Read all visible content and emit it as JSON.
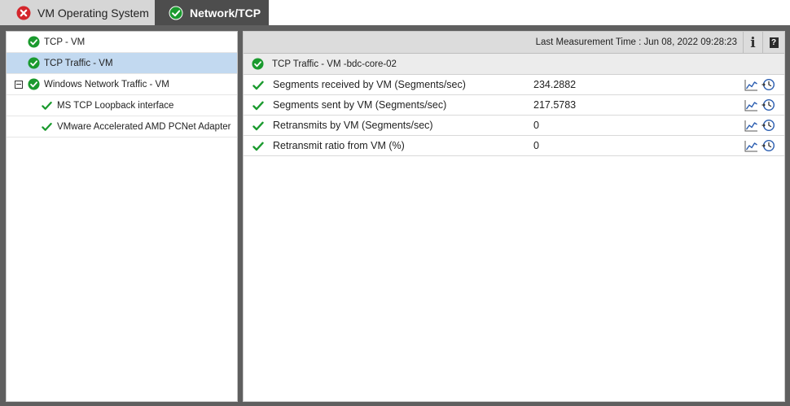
{
  "tabs": [
    {
      "label": "VM Operating System",
      "status": "error"
    },
    {
      "label": "Network/TCP",
      "status": "ok",
      "active": true
    }
  ],
  "tree": [
    {
      "label": "TCP - VM",
      "icon": "ok-circle-icon",
      "selected": false
    },
    {
      "label": "TCP Traffic - VM",
      "icon": "ok-circle-icon",
      "selected": true
    },
    {
      "label": "Windows Network Traffic - VM",
      "icon": "ok-circle-icon",
      "expander": "collapse-icon"
    },
    {
      "label": "MS TCP Loopback interface",
      "icon": "check-icon"
    },
    {
      "label": "VMware Accelerated AMD PCNet Adapter",
      "icon": "check-icon"
    }
  ],
  "header": {
    "measurement_time": "Last Measurement Time : Jun 08, 2022 09:28:23",
    "info_label": "i",
    "help_label": "?"
  },
  "section": {
    "title_prefix": "TCP Traffic - VM - ",
    "host": "bdc-core-02"
  },
  "measures": [
    {
      "label": "Segments received by VM (Segments/sec)",
      "value": "234.2882",
      "status": "ok"
    },
    {
      "label": "Segments sent by VM (Segments/sec)",
      "value": "217.5783",
      "status": "ok"
    },
    {
      "label": "Retransmits by VM (Segments/sec)",
      "value": "0",
      "status": "ok"
    },
    {
      "label": "Retransmit ratio from VM (%)",
      "value": "0",
      "status": "ok"
    }
  ],
  "colors": {
    "ok_green": "#1a9a2e",
    "error_red": "#d4262c",
    "selected_row": "#c2d9f0",
    "active_tab": "#4d4d4d",
    "icon_blue": "#2a5db0"
  }
}
